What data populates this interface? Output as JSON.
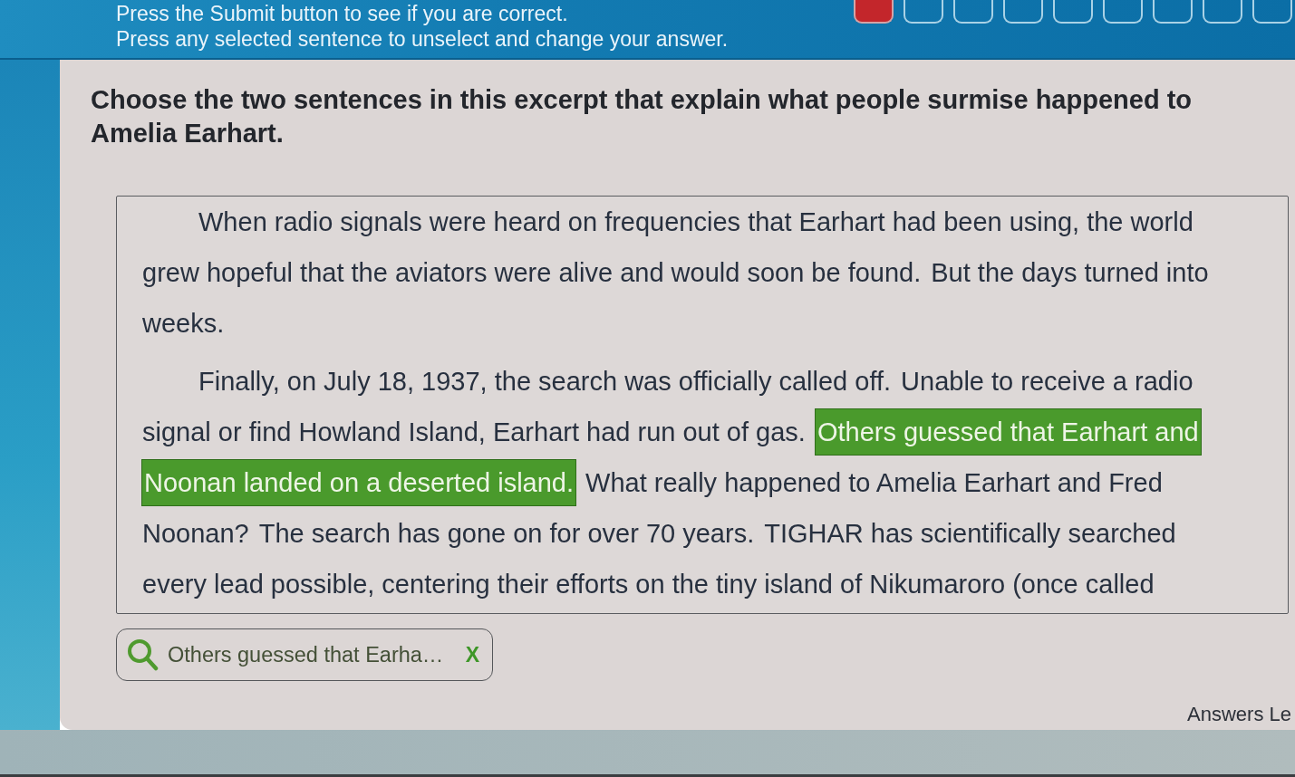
{
  "header": {
    "instructions": [
      "Press the Submit button to see if you are correct.",
      "Press any selected sentence to unselect and change your answer."
    ]
  },
  "progress": [
    {
      "incorrect": true
    },
    {
      "incorrect": false
    },
    {
      "incorrect": false
    },
    {
      "incorrect": false
    },
    {
      "incorrect": false
    },
    {
      "incorrect": false
    },
    {
      "incorrect": false
    },
    {
      "incorrect": false
    },
    {
      "incorrect": false
    }
  ],
  "question": "Choose the two sentences in this excerpt that explain what people surmise happened to Amelia Earhart.",
  "passage": [
    {
      "lines": [
        {
          "segments": [
            {
              "text": "When radio signals were heard on frequencies that Earhart had been using, the world",
              "selected": false
            }
          ]
        },
        {
          "segments": [
            {
              "text": "grew hopeful that the aviators were alive and would soon be found.",
              "selected": false
            },
            {
              "text": "But the days turned into",
              "selected": false
            }
          ]
        },
        {
          "segments": [
            {
              "text": "weeks.",
              "selected": false
            }
          ]
        }
      ]
    },
    {
      "lines": [
        {
          "segments": [
            {
              "text": "Finally, on July 18, 1937, the search was officially called off.",
              "selected": false
            },
            {
              "text": "Unable to receive a radio",
              "selected": false
            }
          ]
        },
        {
          "segments": [
            {
              "text": "signal or find Howland Island, Earhart had run out of gas.",
              "selected": false
            },
            {
              "text": "Others guessed that Earhart and",
              "selected": true
            }
          ]
        },
        {
          "segments": [
            {
              "text": "Noonan landed on a deserted island.",
              "selected": true
            },
            {
              "text": "What really happened to Amelia Earhart and Fred",
              "selected": false
            }
          ]
        },
        {
          "segments": [
            {
              "text": "Noonan?",
              "selected": false
            },
            {
              "text": "The search has gone on for over 70 years.",
              "selected": false
            },
            {
              "text": "TIGHAR has scientifically searched",
              "selected": false
            }
          ]
        },
        {
          "segments": [
            {
              "text": "every lead possible, centering their efforts on the tiny island of Nikumaroro (once called",
              "selected": false
            }
          ]
        }
      ]
    }
  ],
  "selection_chips": [
    {
      "text": "Others guessed that Earha…",
      "close": "X"
    }
  ],
  "footer": {
    "label": "Answers Le"
  }
}
